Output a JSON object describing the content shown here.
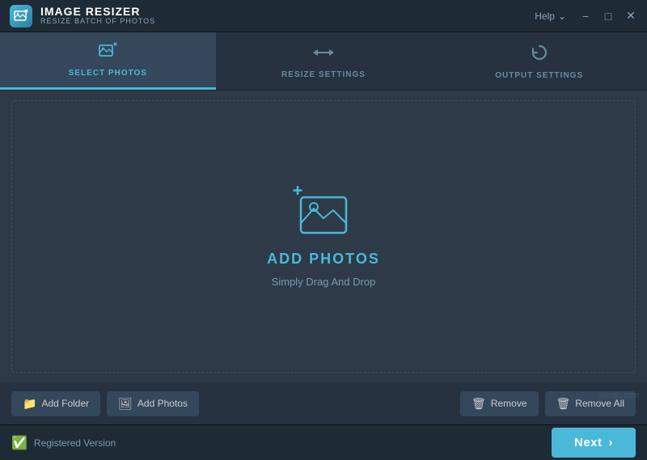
{
  "titleBar": {
    "appName": "IMAGE RESIZER",
    "appSubtitle": "RESIZE BATCH OF PHOTOS",
    "helpLabel": "Help",
    "minimizeLabel": "−",
    "maximizeLabel": "□",
    "closeLabel": "✕"
  },
  "tabs": [
    {
      "id": "select",
      "label": "SELECT PHOTOS",
      "icon": "⤡",
      "active": true
    },
    {
      "id": "resize",
      "label": "RESIZE SETTINGS",
      "icon": "⏭",
      "active": false
    },
    {
      "id": "output",
      "label": "OUTPUT SETTINGS",
      "icon": "↺",
      "active": false
    }
  ],
  "dropZone": {
    "addPhotosLabel": "ADD PHOTOS",
    "dragDropLabel": "Simply Drag And Drop"
  },
  "toolbar": {
    "addFolderLabel": "Add Folder",
    "addPhotosLabel": "Add Photos",
    "removeLabel": "Remove",
    "removeAllLabel": "Remove All"
  },
  "statusBar": {
    "registeredLabel": "Registered Version",
    "nextLabel": "Next"
  },
  "watermark": "wscdn.com"
}
